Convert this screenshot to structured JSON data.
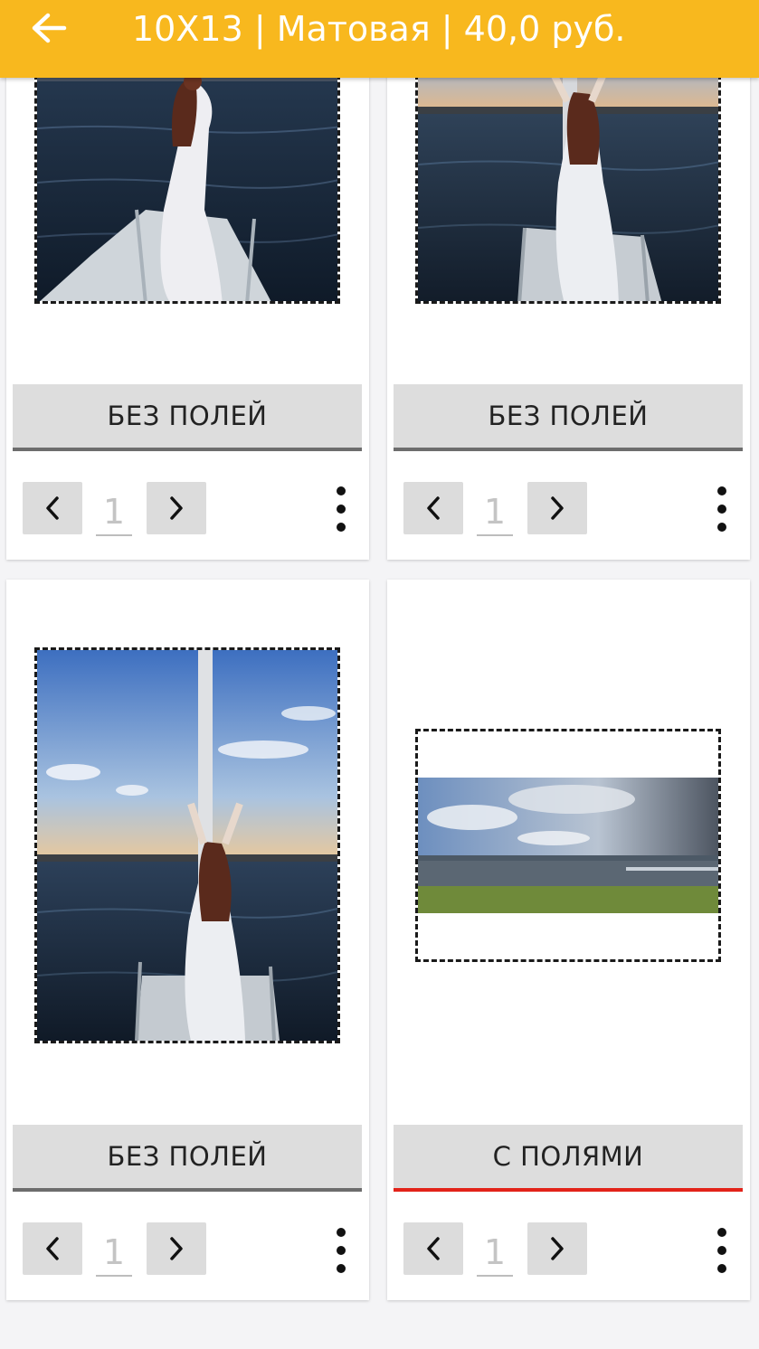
{
  "header": {
    "title": "10X13 | Матовая | 40,0 руб."
  },
  "cards": [
    {
      "mode_label": "БЕЗ ПОЛЕЙ",
      "active": false,
      "quantity": "1"
    },
    {
      "mode_label": "БЕЗ ПОЛЕЙ",
      "active": false,
      "quantity": "1"
    },
    {
      "mode_label": "БЕЗ ПОЛЕЙ",
      "active": false,
      "quantity": "1"
    },
    {
      "mode_label": "С ПОЛЯМИ",
      "active": true,
      "quantity": "1"
    }
  ],
  "colors": {
    "appbar": "#f8b81e",
    "active_underline": "#e2231a",
    "inactive_underline": "#6d6d6d"
  }
}
